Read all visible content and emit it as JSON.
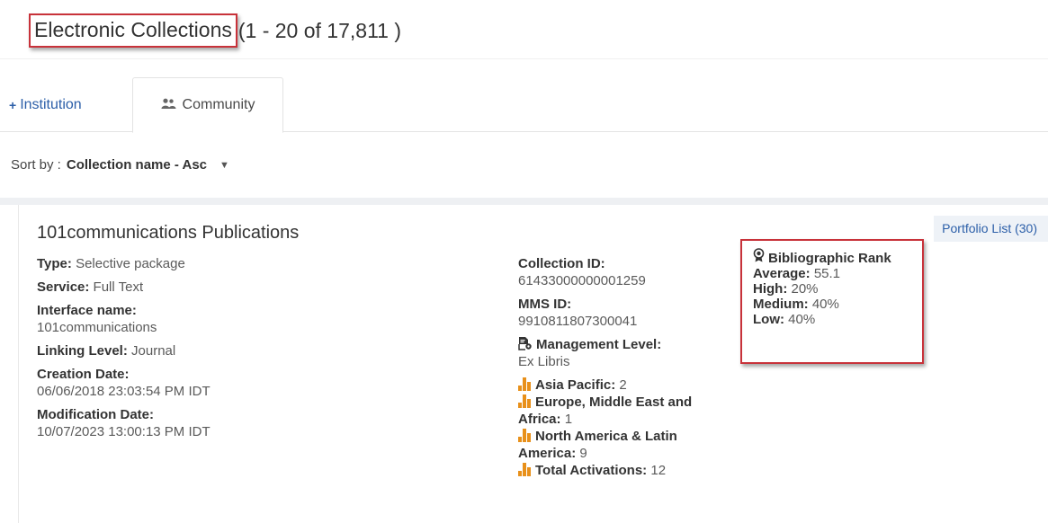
{
  "header": {
    "title": "Electronic Collections",
    "count": "(1 - 20 of 17,811 )"
  },
  "tabs": [
    {
      "label": "Institution",
      "icon": "institution-icon"
    },
    {
      "label": "Community",
      "icon": "community-icon"
    }
  ],
  "sort": {
    "label": "Sort by :",
    "value": "Collection name - Asc"
  },
  "collection": {
    "name": "101communications Publications",
    "portfolio_link": "Portfolio List (30)",
    "type_label": "Type:",
    "type_value": "Selective package",
    "service_label": "Service:",
    "service_value": "Full Text",
    "interface_label": "Interface name:",
    "interface_value": "101communications",
    "linking_label": "Linking Level:",
    "linking_value": "Journal",
    "creation_label": "Creation Date:",
    "creation_value": "06/06/2018 23:03:54 PM IDT",
    "modification_label": "Modification Date:",
    "modification_value": "10/07/2023 13:00:13 PM IDT",
    "collection_id_label": "Collection ID:",
    "collection_id_value": "61433000000001259",
    "mms_id_label": "MMS ID:",
    "mms_id_value": "9910811807300041",
    "management_label": "Management Level:",
    "management_value": "Ex Libris",
    "regions": [
      {
        "label": "Asia Pacific:",
        "value": "2"
      },
      {
        "label": "Europe, Middle East and Africa:",
        "value": "1"
      },
      {
        "label": "North America & Latin America:",
        "value": "9"
      },
      {
        "label": "Total Activations:",
        "value": "12"
      }
    ]
  },
  "rank": {
    "title": "Bibliographic Rank",
    "average_label": "Average:",
    "average_value": "55.1",
    "high_label": "High:",
    "high_value": "20%",
    "medium_label": "Medium:",
    "medium_value": "40%",
    "low_label": "Low:",
    "low_value": "40%"
  },
  "colors": {
    "highlight_border": "#c8323a",
    "link": "#2b5ea8",
    "bar_icon": "#e8901a"
  }
}
